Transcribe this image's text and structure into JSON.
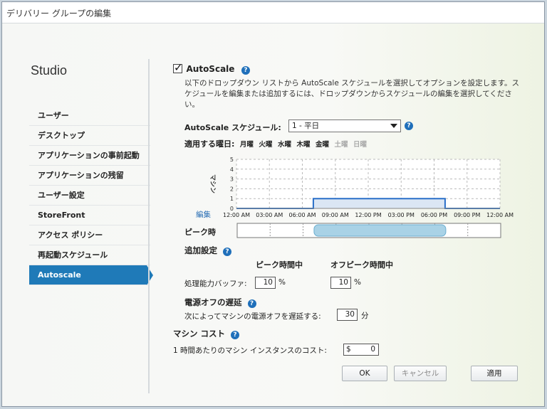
{
  "window": {
    "title": "デリバリー グループの編集"
  },
  "sidebar": {
    "heading": "Studio",
    "items": [
      {
        "label": "ユーザー"
      },
      {
        "label": "デスクトップ"
      },
      {
        "label": "アプリケーションの事前起動"
      },
      {
        "label": "アプリケーションの残留"
      },
      {
        "label": "ユーザー設定"
      },
      {
        "label": "StoreFront"
      },
      {
        "label": "アクセス ポリシー"
      },
      {
        "label": "再起動スケジュール"
      },
      {
        "label": "Autoscale"
      }
    ],
    "active_index": 8
  },
  "autoscale": {
    "label": "AutoScale",
    "checked": true,
    "description": "以下のドロップダウン リストから AutoScale スケジュールを選択してオプションを設定します。スケジュールを編集または追加するには、ドロップダウンからスケジュールの編集を選択してください。",
    "schedule_label": "AutoScale スケジュール:",
    "schedule_value": "1 - 平日",
    "days_label": "適用する曜日:",
    "days": [
      {
        "label": "月曜",
        "active": true
      },
      {
        "label": "火曜",
        "active": true
      },
      {
        "label": "水曜",
        "active": true
      },
      {
        "label": "木曜",
        "active": true
      },
      {
        "label": "金曜",
        "active": true
      },
      {
        "label": "土曜",
        "active": false
      },
      {
        "label": "日曜",
        "active": false
      }
    ],
    "edit_link": "編集",
    "peak_label": "ピーク時"
  },
  "chart_data": {
    "type": "line",
    "ylabel": "マシン",
    "y_ticks": [
      0,
      1,
      2,
      3,
      4,
      5
    ],
    "ylim": [
      0,
      5
    ],
    "x_ticks": [
      "12:00 AM",
      "03:00 AM",
      "06:00 AM",
      "09:00 AM",
      "12:00 PM",
      "03:00 PM",
      "06:00 PM",
      "09:00 PM",
      "12:00 AM"
    ],
    "xlim_hours": [
      0,
      24
    ],
    "series": [
      {
        "x": [
          0,
          7,
          7,
          19,
          19,
          24
        ],
        "y": [
          0,
          0,
          1,
          1,
          0,
          0
        ]
      }
    ],
    "peak_range_hours": [
      7,
      19
    ],
    "line_color": "#2a6fc9",
    "fill_color": "#dbe6f4"
  },
  "additional": {
    "heading": "追加設定",
    "col_peak": "ピーク時間中",
    "col_offpeak": "オフピーク時間中",
    "buffer_label": "処理能力バッファ:",
    "peak_buffer": "10",
    "offpeak_buffer": "10",
    "unit_percent": "%"
  },
  "power_off": {
    "heading": "電源オフの遅延",
    "label": "次によってマシンの電源オフを遅延する:",
    "value": "30",
    "unit": "分"
  },
  "cost": {
    "heading": "マシン コスト",
    "label": "1 時間あたりのマシン インスタンスのコスト:",
    "currency": "$",
    "value": "0"
  },
  "buttons": {
    "ok": "OK",
    "cancel": "キャンセル",
    "apply": "適用"
  }
}
